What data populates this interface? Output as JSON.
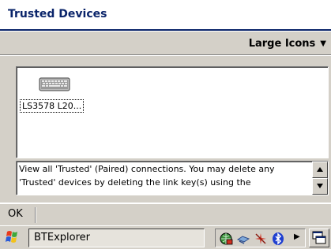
{
  "window": {
    "title": "Trusted Devices"
  },
  "view_menu": {
    "selected": "Large Icons",
    "icon": "chevron-down-icon"
  },
  "devices": [
    {
      "label": "LS3578 L20...",
      "icon": "keyboard-icon"
    }
  ],
  "description": {
    "text": "View all 'Trusted' (Paired) connections.  You may delete any 'Trusted' devices by deleting the link key(s) using the"
  },
  "menu_bar": {
    "ok_label": "OK"
  },
  "taskbar": {
    "start_icon": "windows-flag-icon",
    "active_task": "BTExplorer",
    "tray_icons": [
      "globe-network-icon",
      "connectivity-icon",
      "wireless-icon",
      "bluetooth-icon"
    ],
    "tray_arrow_icon": "chevron-right-icon",
    "desktop_icon": "show-desktop-icon"
  },
  "colors": {
    "title_text": "#0a246a",
    "chrome": "#d4d0c8",
    "bluetooth": "#1f3fd0"
  }
}
